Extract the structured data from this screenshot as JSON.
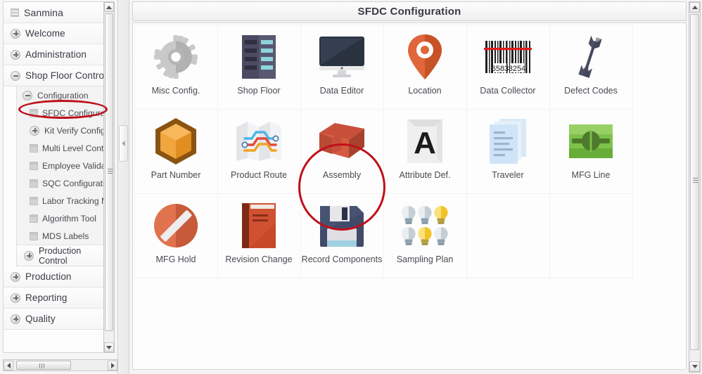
{
  "window": {
    "title": "SFDC Configuration"
  },
  "sidebar": {
    "root_label": "Sanmina",
    "items": [
      {
        "label": "Welcome",
        "state": "collapsed",
        "icon": "plus-circle-icon"
      },
      {
        "label": "Administration",
        "state": "collapsed",
        "icon": "plus-circle-icon"
      },
      {
        "label": "Shop Floor Control",
        "state": "expanded",
        "icon": "minus-circle-icon"
      }
    ],
    "shop_floor_children": [
      {
        "label": "Configuration",
        "state": "expanded",
        "icon": "minus-circle-icon",
        "level": 1
      },
      {
        "label": "SFDC Configuration",
        "state": "leaf",
        "icon": "document-icon",
        "level": 2,
        "highlighted": true
      },
      {
        "label": "Kit Verify Config",
        "state": "collapsed",
        "icon": "plus-circle-icon",
        "level": 2
      },
      {
        "label": "Multi Level Container C",
        "state": "leaf",
        "icon": "document-icon",
        "level": 2
      },
      {
        "label": "Employee Validation",
        "state": "leaf",
        "icon": "document-icon",
        "level": 2
      },
      {
        "label": "SQC Configuration",
        "state": "leaf",
        "icon": "document-icon",
        "level": 2
      },
      {
        "label": "Labor Tracking Mainte",
        "state": "leaf",
        "icon": "document-icon",
        "level": 2
      },
      {
        "label": "Algorithm Tool",
        "state": "leaf",
        "icon": "document-icon",
        "level": 2
      },
      {
        "label": "MDS Labels",
        "state": "leaf",
        "icon": "document-icon",
        "level": 2
      }
    ],
    "shop_floor_trailing": {
      "label": "Production Control",
      "state": "collapsed",
      "icon": "plus-circle-icon"
    },
    "bottom_items": [
      {
        "label": "Production",
        "state": "collapsed",
        "icon": "plus-circle-icon"
      },
      {
        "label": "Reporting",
        "state": "collapsed",
        "icon": "plus-circle-icon"
      },
      {
        "label": "Quality",
        "state": "collapsed",
        "icon": "plus-circle-icon"
      }
    ]
  },
  "annotations": {
    "sidebar_highlight_target": "SFDC Configuration",
    "tile_highlight_target": "Assembly",
    "color": "#c0101a"
  },
  "tiles": [
    {
      "label": "Misc Config.",
      "icon": "gear-icon"
    },
    {
      "label": "Shop Floor",
      "icon": "server-rack-icon"
    },
    {
      "label": "Data Editor",
      "icon": "monitor-icon"
    },
    {
      "label": "Location",
      "icon": "map-pin-icon"
    },
    {
      "label": "Data Collector",
      "icon": "barcode-icon",
      "barcode_digits_left": "6583",
      "barcode_digits_right": "3254"
    },
    {
      "label": "Defect Codes",
      "icon": "wrench-icon"
    },
    {
      "label": "Part Number",
      "icon": "hexagon-cube-icon"
    },
    {
      "label": "Product Route",
      "icon": "route-map-icon"
    },
    {
      "label": "Assembly",
      "icon": "box-3d-icon",
      "highlighted": true
    },
    {
      "label": "Attribute Def.",
      "icon": "letter-a-page-icon",
      "glyph": "A"
    },
    {
      "label": "Traveler",
      "icon": "documents-icon"
    },
    {
      "label": "MFG Line",
      "icon": "production-line-icon"
    },
    {
      "label": "MFG Hold",
      "icon": "no-entry-icon"
    },
    {
      "label": "Revision Change",
      "icon": "book-icon"
    },
    {
      "label": "Record Components",
      "icon": "floppy-disk-icon"
    },
    {
      "label": "Sampling Plan",
      "icon": "lightbulbs-icon",
      "bulbs_on": [
        3,
        5
      ],
      "bulbs_total": 6
    }
  ],
  "scrollbars": {
    "nav_vertical": {
      "up": "scroll-up",
      "down": "scroll-down"
    },
    "nav_horizontal": {
      "left": "scroll-left",
      "right": "scroll-right"
    },
    "main_vertical": {
      "up": "scroll-up",
      "down": "scroll-down"
    }
  },
  "splitter": {
    "collapse_label": "collapse-left"
  }
}
